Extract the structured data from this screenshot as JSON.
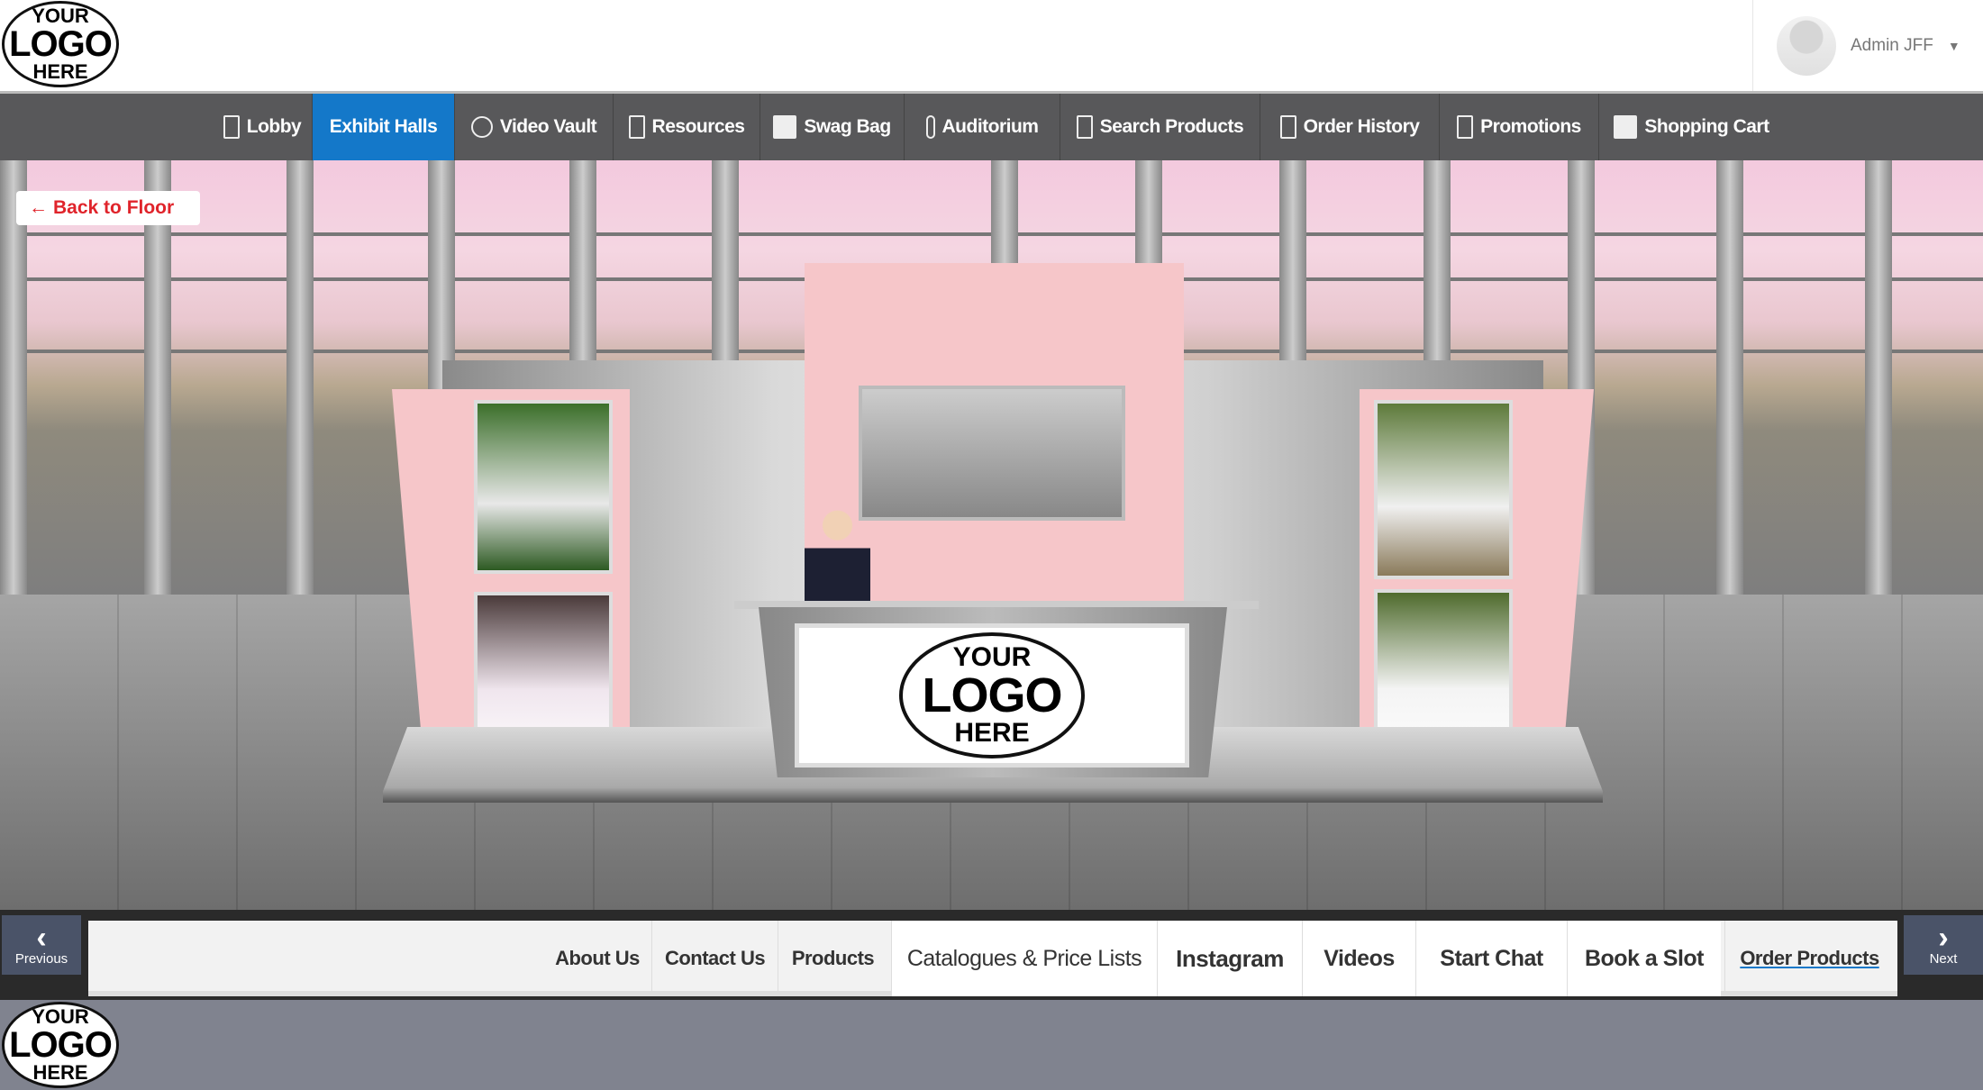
{
  "header": {
    "logo": {
      "line1": "YOUR",
      "line2": "LOGO",
      "line3": "HERE"
    },
    "user": {
      "name": "Admin JFF",
      "icon": "user-avatar-icon",
      "dropdown_icon": "caret-down-icon"
    }
  },
  "nav": {
    "active_color": "#1478c9",
    "items": [
      {
        "label": "Lobby",
        "icon": "building-icon"
      },
      {
        "label": "Exhibit Halls",
        "icon": "",
        "active": true
      },
      {
        "label": "Video Vault",
        "icon": "play-circle-icon"
      },
      {
        "label": "Resources",
        "icon": "document-icon"
      },
      {
        "label": "Swag Bag",
        "icon": "bag-icon"
      },
      {
        "label": "Auditorium",
        "icon": "podium-icon"
      },
      {
        "label": "Search Products",
        "icon": "document-icon"
      },
      {
        "label": "Order History",
        "icon": "document-icon"
      },
      {
        "label": "Promotions",
        "icon": "document-icon"
      },
      {
        "label": "Shopping Cart",
        "icon": "bag-icon"
      }
    ]
  },
  "scene": {
    "back_button": "Back to Floor",
    "back_icon": "arrow-left-icon",
    "booth_logo": {
      "line1": "YOUR",
      "line2": "LOGO",
      "line3": "HERE"
    }
  },
  "booth_nav": {
    "previous": "Previous",
    "next": "Next",
    "links": [
      "About Us",
      "Contact Us",
      "Products",
      "Catalogues & Price Lists",
      "Instagram",
      "Videos",
      "Start Chat",
      "Book a Slot",
      "Order Products"
    ]
  },
  "footer": {
    "logo": {
      "line1": "YOUR",
      "line2": "LOGO",
      "line3": "HERE"
    }
  }
}
